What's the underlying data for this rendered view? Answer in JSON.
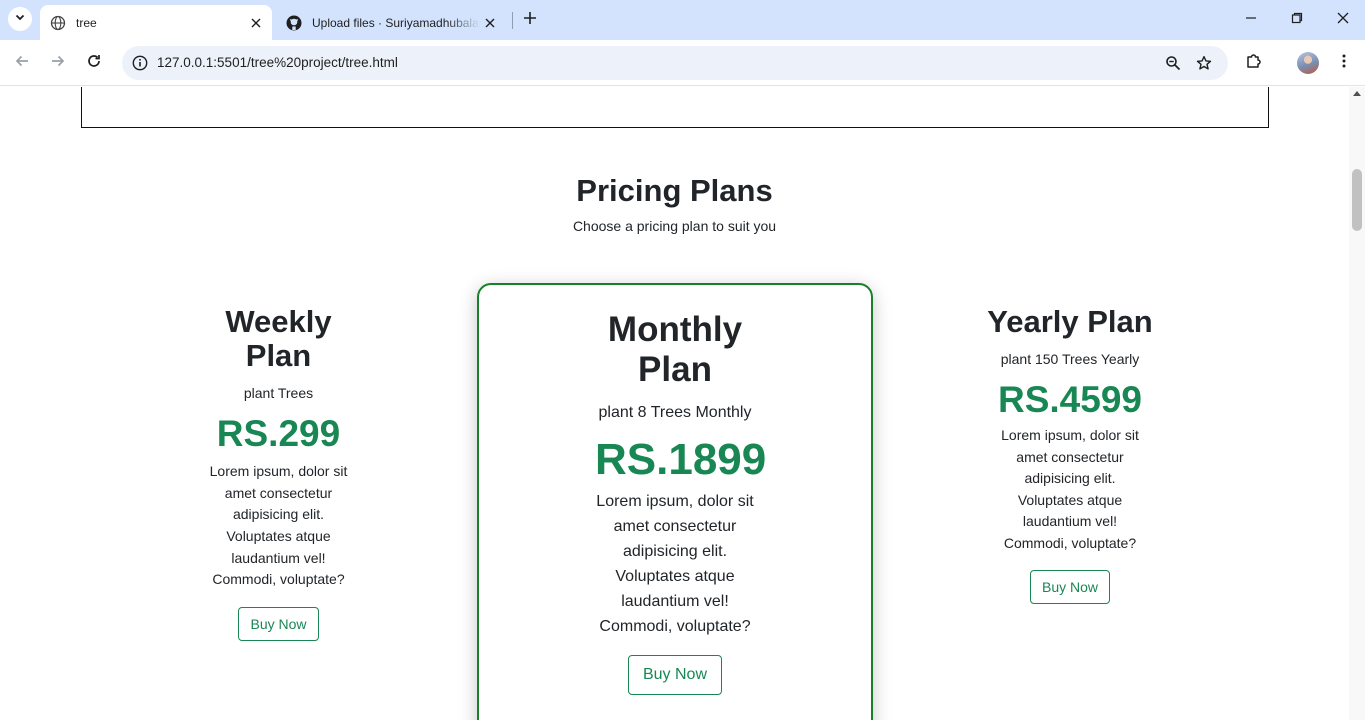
{
  "browser": {
    "active_tab_title": "tree",
    "inactive_tab_title": "Upload files · Suriyamadhubalan",
    "url": "127.0.0.1:5501/tree%20project/tree.html",
    "icons": {
      "tab_list": "chevron-down-icon",
      "active_favicon": "globe-icon",
      "inactive_favicon": "github-icon",
      "close": "close-icon",
      "new_tab": "plus-icon",
      "back": "back-arrow-icon",
      "forward": "forward-arrow-icon",
      "reload": "reload-icon",
      "site_info": "info-icon",
      "zoom": "zoom-icon",
      "bookmark": "star-icon",
      "extensions": "puzzle-icon",
      "menu": "kebab-menu-icon"
    }
  },
  "pricing": {
    "title": "Pricing Plans",
    "subtitle": "Choose a pricing plan to suit you",
    "plans": [
      {
        "name": "Weekly Plan",
        "sub": "plant Trees",
        "price": "RS.299",
        "desc": "Lorem ipsum, dolor sit amet consectetur adipisicing elit. Voluptates atque laudantium vel! Commodi, voluptate?",
        "button": "Buy Now"
      },
      {
        "name": "Monthly Plan",
        "sub": "plant 8 Trees Monthly",
        "price": "RS.1899",
        "desc": "Lorem ipsum, dolor sit amet consectetur adipisicing elit. Voluptates atque laudantium vel! Commodi, voluptate?",
        "button": "Buy Now"
      },
      {
        "name": "Yearly Plan",
        "sub": "plant 150 Trees Yearly",
        "price": "RS.4599",
        "desc": "Lorem ipsum, dolor sit amet consectetur adipisicing elit. Voluptates atque laudantium vel! Commodi, voluptate?",
        "button": "Buy Now"
      }
    ]
  },
  "colors": {
    "accent_green": "#198754",
    "featured_border": "#1a7f2a",
    "tabstrip": "#d3e3fd"
  }
}
